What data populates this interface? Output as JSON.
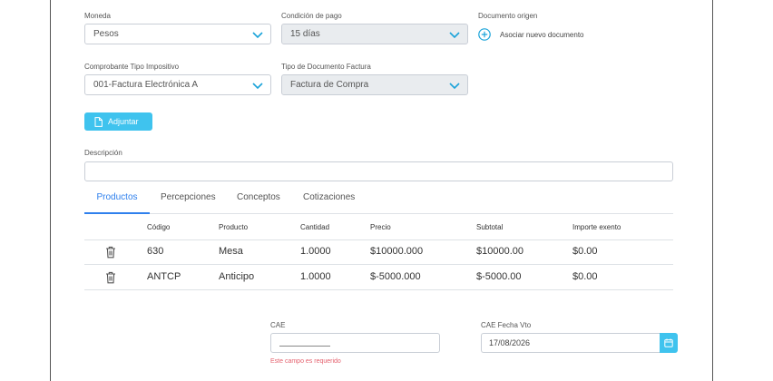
{
  "form": {
    "moneda": {
      "label": "Moneda",
      "value": "Pesos"
    },
    "condicion_pago": {
      "label": "Condición de pago",
      "value": "15 días"
    },
    "documento_origen": {
      "label": "Documento origen",
      "add_label": "Asociar nuevo documento"
    },
    "comprobante": {
      "label": "Comprobante Tipo Impositivo",
      "value": "001-Factura Electrónica A"
    },
    "tipo_documento": {
      "label": "Tipo de Documento Factura",
      "value": "Factura de Compra"
    },
    "attach_label": "Adjuntar",
    "descripcion": {
      "label": "Descripción",
      "value": ""
    }
  },
  "tabs": [
    {
      "label": "Productos",
      "active": true
    },
    {
      "label": "Percepciones"
    },
    {
      "label": "Conceptos"
    },
    {
      "label": "Cotizaciones"
    }
  ],
  "table": {
    "headers": [
      "Código",
      "Producto",
      "Cantidad",
      "Precio",
      "Subtotal",
      "Importe exento"
    ],
    "rows": [
      [
        "630",
        "Mesa",
        "1.0000",
        "$10000.000",
        "$10000.00",
        "$0.00"
      ],
      [
        "ANTCP",
        "Anticipo",
        "1.0000",
        "$-5000.000",
        "$-5000.00",
        "$0.00"
      ]
    ]
  },
  "cae": {
    "label": "CAE",
    "value": "",
    "error": "Este campo es requerido"
  },
  "cae_vto": {
    "label": "CAE Fecha Vto",
    "value": "17/08/2026"
  },
  "colors": {
    "accent": "#3fc3ee",
    "tab_active": "#2f80ed",
    "error": "#e4606d",
    "chevron": "#1aa3d9"
  }
}
